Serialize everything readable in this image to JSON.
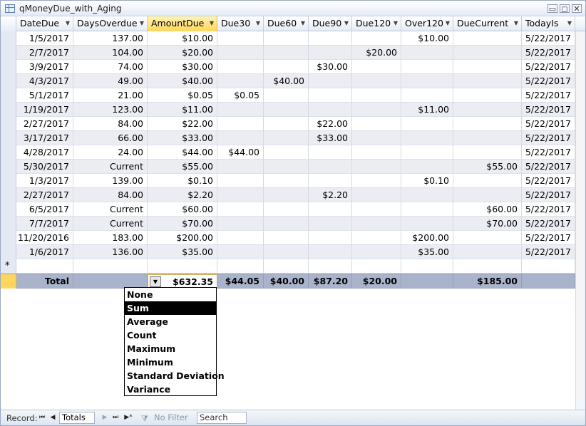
{
  "window": {
    "title": "qMoneyDue_with_Aging",
    "minimize_glyph": "▭",
    "restore_glyph": "◻",
    "close_glyph": "✕"
  },
  "columns": [
    {
      "label": "DateDue"
    },
    {
      "label": "DaysOverdue"
    },
    {
      "label": "AmountDue"
    },
    {
      "label": "Due30"
    },
    {
      "label": "Due60"
    },
    {
      "label": "Due90"
    },
    {
      "label": "Due120"
    },
    {
      "label": "Over120"
    },
    {
      "label": "DueCurrent"
    },
    {
      "label": "TodayIs"
    }
  ],
  "rows": [
    [
      "1/5/2017",
      "137.00",
      "$10.00",
      "",
      "",
      "",
      "",
      "$10.00",
      "",
      "5/22/2017"
    ],
    [
      "2/7/2017",
      "104.00",
      "$20.00",
      "",
      "",
      "",
      "$20.00",
      "",
      "",
      "5/22/2017"
    ],
    [
      "3/9/2017",
      "74.00",
      "$30.00",
      "",
      "",
      "$30.00",
      "",
      "",
      "",
      "5/22/2017"
    ],
    [
      "4/3/2017",
      "49.00",
      "$40.00",
      "",
      "$40.00",
      "",
      "",
      "",
      "",
      "5/22/2017"
    ],
    [
      "5/1/2017",
      "21.00",
      "$0.05",
      "$0.05",
      "",
      "",
      "",
      "",
      "",
      "5/22/2017"
    ],
    [
      "1/19/2017",
      "123.00",
      "$11.00",
      "",
      "",
      "",
      "",
      "$11.00",
      "",
      "5/22/2017"
    ],
    [
      "2/27/2017",
      "84.00",
      "$22.00",
      "",
      "",
      "$22.00",
      "",
      "",
      "",
      "5/22/2017"
    ],
    [
      "3/17/2017",
      "66.00",
      "$33.00",
      "",
      "",
      "$33.00",
      "",
      "",
      "",
      "5/22/2017"
    ],
    [
      "4/28/2017",
      "24.00",
      "$44.00",
      "$44.00",
      "",
      "",
      "",
      "",
      "",
      "5/22/2017"
    ],
    [
      "5/30/2017",
      "Current",
      "$55.00",
      "",
      "",
      "",
      "",
      "",
      "$55.00",
      "5/22/2017"
    ],
    [
      "1/3/2017",
      "139.00",
      "$0.10",
      "",
      "",
      "",
      "",
      "$0.10",
      "",
      "5/22/2017"
    ],
    [
      "2/27/2017",
      "84.00",
      "$2.20",
      "",
      "",
      "$2.20",
      "",
      "",
      "",
      "5/22/2017"
    ],
    [
      "6/5/2017",
      "Current",
      "$60.00",
      "",
      "",
      "",
      "",
      "",
      "$60.00",
      "5/22/2017"
    ],
    [
      "7/7/2017",
      "Current",
      "$70.00",
      "",
      "",
      "",
      "",
      "",
      "$70.00",
      "5/22/2017"
    ],
    [
      "11/20/2016",
      "183.00",
      "$200.00",
      "",
      "",
      "",
      "",
      "$200.00",
      "",
      "5/22/2017"
    ],
    [
      "1/6/2017",
      "136.00",
      "$35.00",
      "",
      "",
      "",
      "",
      "$35.00",
      "",
      "5/22/2017"
    ]
  ],
  "new_record_marker": "*",
  "totals": {
    "label": "Total",
    "values": [
      "",
      "",
      "$632.35",
      "$44.05",
      "$40.00",
      "$87.20",
      "$20.00",
      "",
      "$185.00",
      ""
    ],
    "dropdown_glyph": "▼"
  },
  "aggregate_menu": {
    "options": [
      "None",
      "Sum",
      "Average",
      "Count",
      "Maximum",
      "Minimum",
      "Standard Deviation",
      "Variance"
    ],
    "selected": "Sum"
  },
  "navigation": {
    "record_label": "Record:",
    "first_glyph": "⏮",
    "prev_glyph": "◀",
    "current": "Totals",
    "next_glyph": "▶",
    "last_glyph": "⏭",
    "new_glyph": "▶*",
    "filter_icon": "⧩",
    "filter_label": "No Filter",
    "search_placeholder": "Search"
  },
  "colors": {
    "active_header": "#ffd65c",
    "total_row": "#a9b4cc",
    "alt_row": "#ecedf3",
    "menu_selected": "#000000"
  }
}
